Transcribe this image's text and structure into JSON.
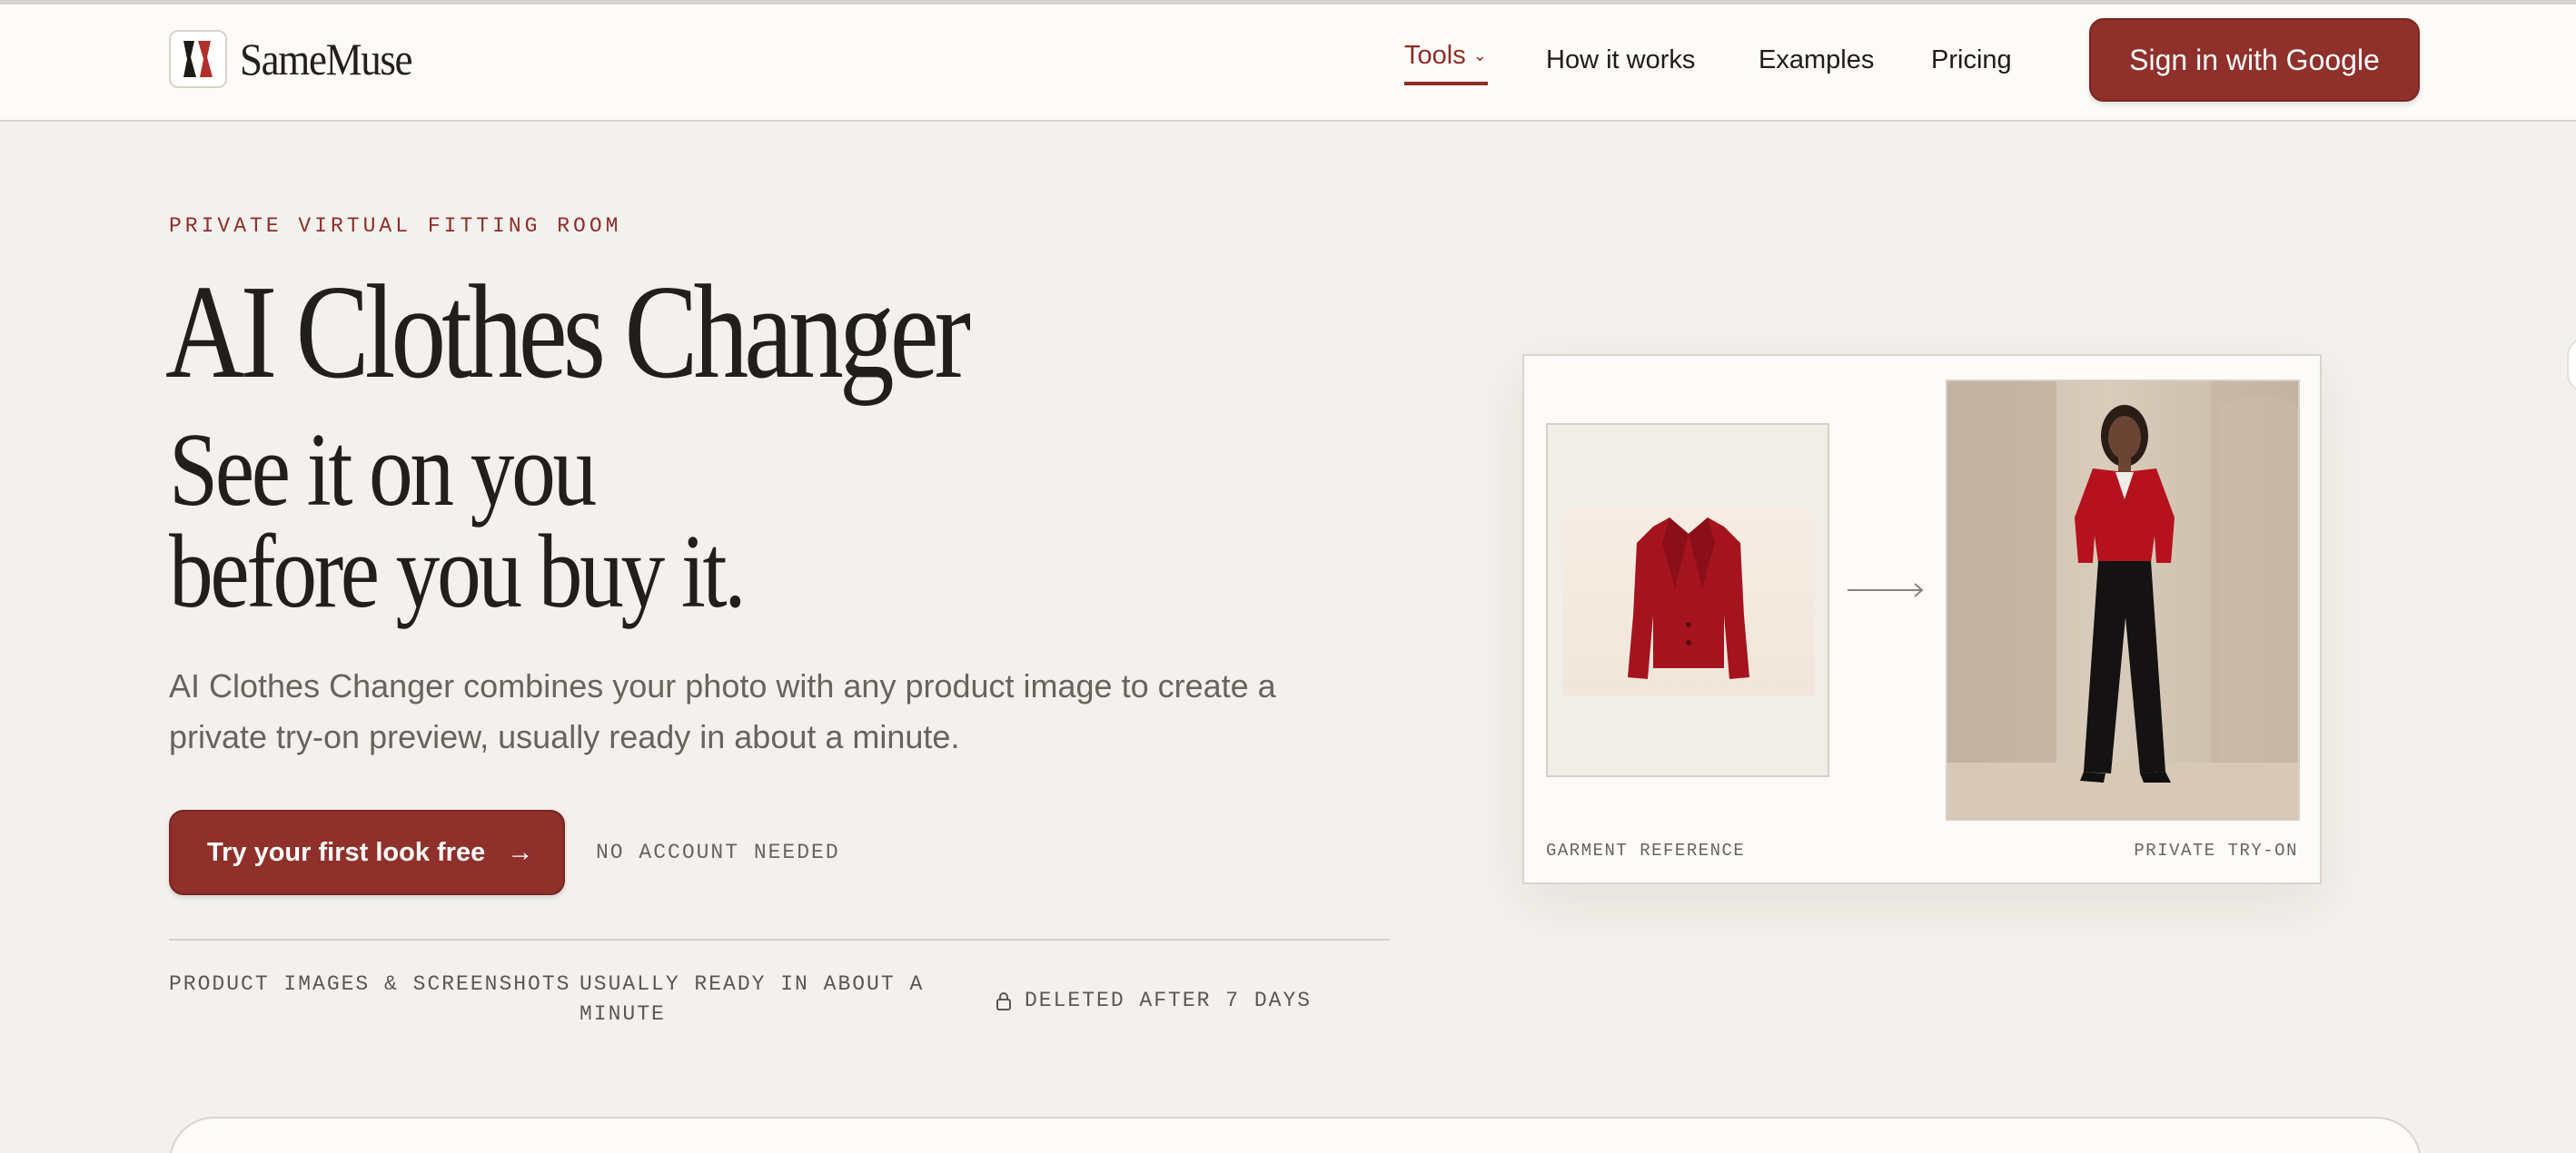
{
  "header": {
    "brand": "SameMuse",
    "nav": [
      {
        "label": "Tools",
        "active": true
      },
      {
        "label": "How it works"
      },
      {
        "label": "Examples"
      },
      {
        "label": "Pricing"
      }
    ],
    "signin_label": "Sign in with Google"
  },
  "hero": {
    "eyebrow": "PRIVATE VIRTUAL FITTING ROOM",
    "title": "AI Clothes Changer",
    "subtitle_line1": "See it on you",
    "subtitle_line2": "before you buy it.",
    "description": "AI Clothes Changer combines your photo with any product image to create a private try-on preview, usually ready in about a minute.",
    "cta_label": "Try your first look free",
    "cta_note": "NO ACCOUNT NEEDED",
    "features": [
      "PRODUCT IMAGES & SCREENSHOTS",
      "USUALLY READY IN ABOUT A MINUTE",
      "DELETED AFTER 7 DAYS"
    ]
  },
  "preview_card": {
    "left_label": "GARMENT REFERENCE",
    "right_label": "PRIVATE TRY-ON"
  },
  "colors": {
    "accent": "#8f302b",
    "background": "#f3f1ed",
    "header_bg": "#fcfbf8"
  },
  "icons": [
    "logo-mark-icon",
    "chevron-down-icon",
    "arrow-right-icon",
    "lock-icon"
  ]
}
